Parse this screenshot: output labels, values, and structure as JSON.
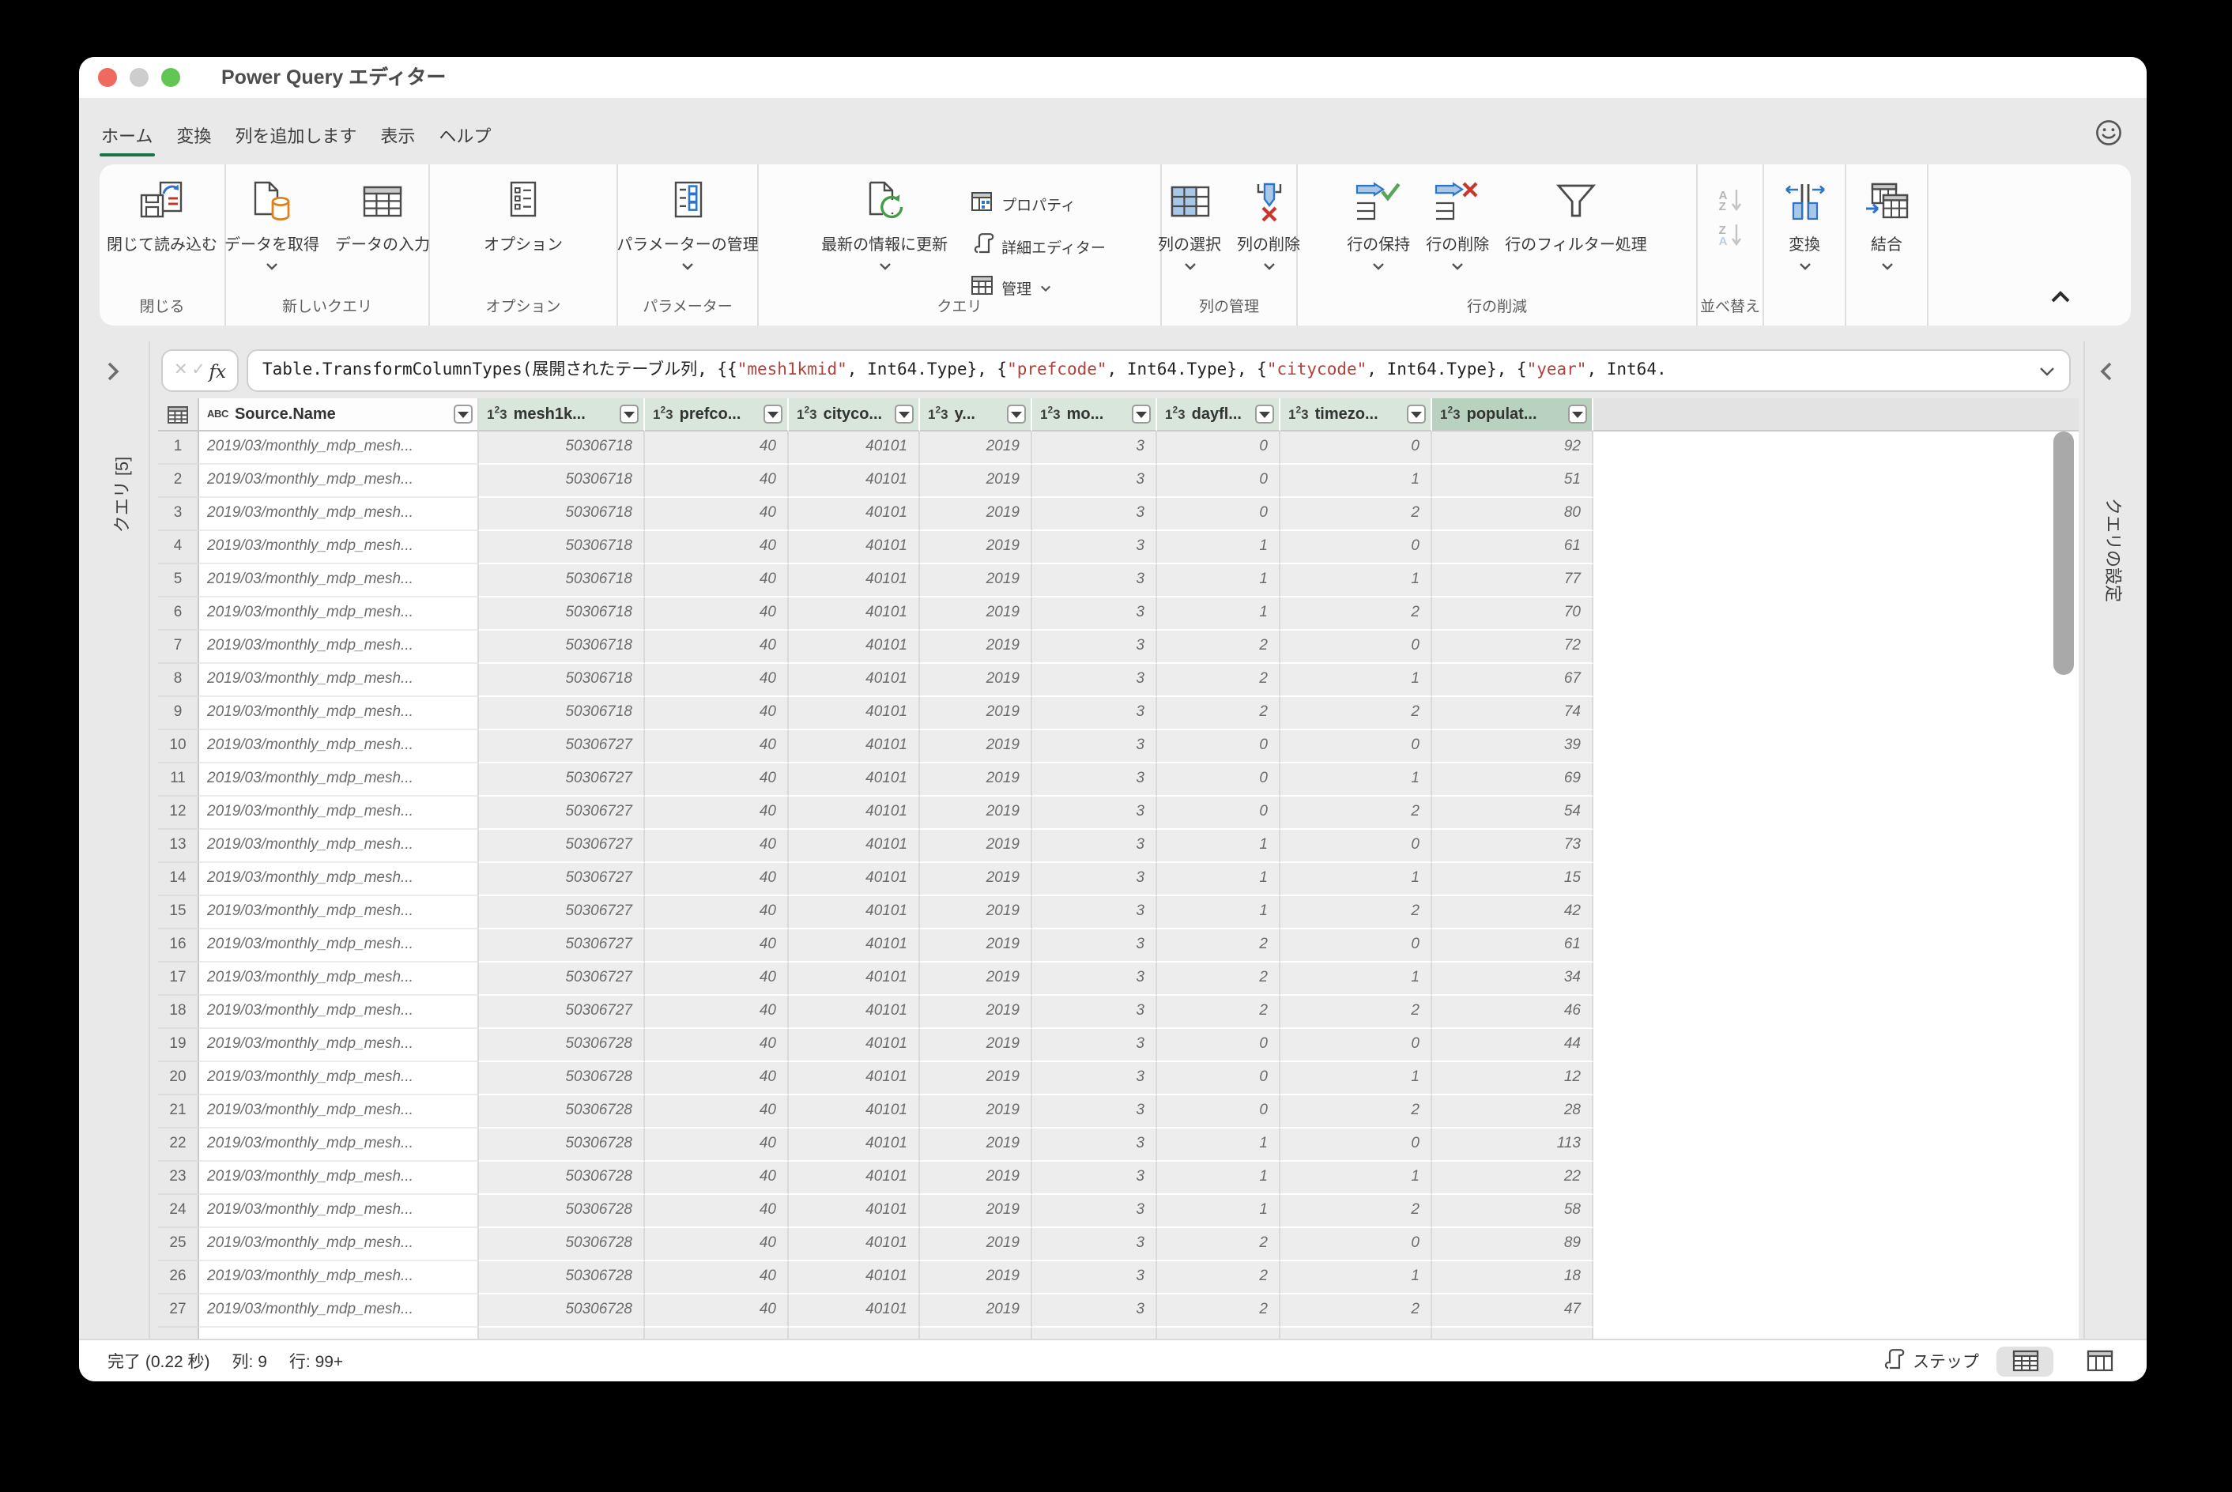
{
  "window_title": "Power Query エディター",
  "menu": {
    "tabs": [
      {
        "label": "ホーム",
        "active": true
      },
      {
        "label": "変換",
        "active": false
      },
      {
        "label": "列を追加します",
        "active": false
      },
      {
        "label": "表示",
        "active": false
      },
      {
        "label": "ヘルプ",
        "active": false
      }
    ]
  },
  "ribbon": {
    "groups": [
      {
        "label": "閉じる",
        "buttons": [
          {
            "label": "閉じて読み込む",
            "chevron": false
          }
        ]
      },
      {
        "label": "新しいクエリ",
        "buttons": [
          {
            "label": "データを取得",
            "chevron": true
          },
          {
            "label": "データの入力",
            "chevron": false
          }
        ]
      },
      {
        "label": "オプション",
        "buttons": [
          {
            "label": "オプション",
            "chevron": false
          }
        ]
      },
      {
        "label": "パラメーター",
        "buttons": [
          {
            "label": "パラメーターの管理",
            "chevron": true
          }
        ]
      },
      {
        "label": "クエリ",
        "buttons": [
          {
            "label": "最新の情報に更新",
            "chevron": true
          }
        ],
        "small_buttons": [
          {
            "label": "プロパティ"
          },
          {
            "label": "詳細エディター"
          },
          {
            "label": "管理",
            "chevron": true
          }
        ]
      },
      {
        "label": "列の管理",
        "buttons": [
          {
            "label": "列の選択",
            "chevron": true
          },
          {
            "label": "列の削除",
            "chevron": true
          }
        ]
      },
      {
        "label": "行の削減",
        "buttons": [
          {
            "label": "行の保持",
            "chevron": true
          },
          {
            "label": "行の削除",
            "chevron": true
          },
          {
            "label": "行のフィルター処理",
            "chevron": false
          }
        ]
      },
      {
        "label": "並べ替え",
        "buttons": []
      },
      {
        "label": "",
        "buttons": [
          {
            "label": "変換",
            "chevron": true
          }
        ]
      },
      {
        "label": "",
        "buttons": [
          {
            "label": "結合",
            "chevron": true
          }
        ]
      }
    ]
  },
  "formula_bar": {
    "segments": [
      {
        "kind": "code",
        "text": "Table.TransformColumnTypes(展開されたテーブル列, {{"
      },
      {
        "kind": "string",
        "text": "\"mesh1kmid\""
      },
      {
        "kind": "code",
        "text": ", Int64.Type}, {"
      },
      {
        "kind": "string",
        "text": "\"prefcode\""
      },
      {
        "kind": "code",
        "text": ", Int64.Type}, {"
      },
      {
        "kind": "string",
        "text": "\"citycode\""
      },
      {
        "kind": "code",
        "text": ", Int64.Type}, {"
      },
      {
        "kind": "string",
        "text": "\"year\""
      },
      {
        "kind": "code",
        "text": ", Int64."
      }
    ]
  },
  "left_panel": {
    "title": "クエリ [5]"
  },
  "right_panel": {
    "title": "クエリの設定"
  },
  "table": {
    "columns": [
      {
        "name": "Source.Name",
        "type": "text",
        "selected": false
      },
      {
        "name": "mesh1k...",
        "type": "number",
        "selected": false
      },
      {
        "name": "prefco...",
        "type": "number",
        "selected": false
      },
      {
        "name": "cityco...",
        "type": "number",
        "selected": false
      },
      {
        "name": "y...",
        "type": "number",
        "selected": false
      },
      {
        "name": "mo...",
        "type": "number",
        "selected": false
      },
      {
        "name": "dayfl...",
        "type": "number",
        "selected": false
      },
      {
        "name": "timezo...",
        "type": "number",
        "selected": false
      },
      {
        "name": "populat...",
        "type": "number",
        "selected": true
      }
    ],
    "rows": [
      [
        "2019/03/monthly_mdp_mesh...",
        "50306718",
        "40",
        "40101",
        "2019",
        "3",
        "0",
        "0",
        "92"
      ],
      [
        "2019/03/monthly_mdp_mesh...",
        "50306718",
        "40",
        "40101",
        "2019",
        "3",
        "0",
        "1",
        "51"
      ],
      [
        "2019/03/monthly_mdp_mesh...",
        "50306718",
        "40",
        "40101",
        "2019",
        "3",
        "0",
        "2",
        "80"
      ],
      [
        "2019/03/monthly_mdp_mesh...",
        "50306718",
        "40",
        "40101",
        "2019",
        "3",
        "1",
        "0",
        "61"
      ],
      [
        "2019/03/monthly_mdp_mesh...",
        "50306718",
        "40",
        "40101",
        "2019",
        "3",
        "1",
        "1",
        "77"
      ],
      [
        "2019/03/monthly_mdp_mesh...",
        "50306718",
        "40",
        "40101",
        "2019",
        "3",
        "1",
        "2",
        "70"
      ],
      [
        "2019/03/monthly_mdp_mesh...",
        "50306718",
        "40",
        "40101",
        "2019",
        "3",
        "2",
        "0",
        "72"
      ],
      [
        "2019/03/monthly_mdp_mesh...",
        "50306718",
        "40",
        "40101",
        "2019",
        "3",
        "2",
        "1",
        "67"
      ],
      [
        "2019/03/monthly_mdp_mesh...",
        "50306718",
        "40",
        "40101",
        "2019",
        "3",
        "2",
        "2",
        "74"
      ],
      [
        "2019/03/monthly_mdp_mesh...",
        "50306727",
        "40",
        "40101",
        "2019",
        "3",
        "0",
        "0",
        "39"
      ],
      [
        "2019/03/monthly_mdp_mesh...",
        "50306727",
        "40",
        "40101",
        "2019",
        "3",
        "0",
        "1",
        "69"
      ],
      [
        "2019/03/monthly_mdp_mesh...",
        "50306727",
        "40",
        "40101",
        "2019",
        "3",
        "0",
        "2",
        "54"
      ],
      [
        "2019/03/monthly_mdp_mesh...",
        "50306727",
        "40",
        "40101",
        "2019",
        "3",
        "1",
        "0",
        "73"
      ],
      [
        "2019/03/monthly_mdp_mesh...",
        "50306727",
        "40",
        "40101",
        "2019",
        "3",
        "1",
        "1",
        "15"
      ],
      [
        "2019/03/monthly_mdp_mesh...",
        "50306727",
        "40",
        "40101",
        "2019",
        "3",
        "1",
        "2",
        "42"
      ],
      [
        "2019/03/monthly_mdp_mesh...",
        "50306727",
        "40",
        "40101",
        "2019",
        "3",
        "2",
        "0",
        "61"
      ],
      [
        "2019/03/monthly_mdp_mesh...",
        "50306727",
        "40",
        "40101",
        "2019",
        "3",
        "2",
        "1",
        "34"
      ],
      [
        "2019/03/monthly_mdp_mesh...",
        "50306727",
        "40",
        "40101",
        "2019",
        "3",
        "2",
        "2",
        "46"
      ],
      [
        "2019/03/monthly_mdp_mesh...",
        "50306728",
        "40",
        "40101",
        "2019",
        "3",
        "0",
        "0",
        "44"
      ],
      [
        "2019/03/monthly_mdp_mesh...",
        "50306728",
        "40",
        "40101",
        "2019",
        "3",
        "0",
        "1",
        "12"
      ],
      [
        "2019/03/monthly_mdp_mesh...",
        "50306728",
        "40",
        "40101",
        "2019",
        "3",
        "0",
        "2",
        "28"
      ],
      [
        "2019/03/monthly_mdp_mesh...",
        "50306728",
        "40",
        "40101",
        "2019",
        "3",
        "1",
        "0",
        "113"
      ],
      [
        "2019/03/monthly_mdp_mesh...",
        "50306728",
        "40",
        "40101",
        "2019",
        "3",
        "1",
        "1",
        "22"
      ],
      [
        "2019/03/monthly_mdp_mesh...",
        "50306728",
        "40",
        "40101",
        "2019",
        "3",
        "1",
        "2",
        "58"
      ],
      [
        "2019/03/monthly_mdp_mesh...",
        "50306728",
        "40",
        "40101",
        "2019",
        "3",
        "2",
        "0",
        "89"
      ],
      [
        "2019/03/monthly_mdp_mesh...",
        "50306728",
        "40",
        "40101",
        "2019",
        "3",
        "2",
        "1",
        "18"
      ],
      [
        "2019/03/monthly_mdp_mesh...",
        "50306728",
        "40",
        "40101",
        "2019",
        "3",
        "2",
        "2",
        "47"
      ]
    ]
  },
  "statusbar": {
    "status": "完了 (0.22 秒)",
    "columns_info": "列: 9",
    "rows_info": "行: 99+",
    "steps_label": "ステップ"
  },
  "colors": {
    "accent_green": "#1c7145",
    "header_green": "#d8e6db",
    "header_green_selected": "#b9d2bf",
    "traffic_red": "#ee6a5f",
    "traffic_gray": "#cdcdcd",
    "traffic_green": "#62c554",
    "formula_string_red": "#b3403a"
  },
  "icons": {
    "titlebar": [
      "close",
      "minimize",
      "zoom"
    ],
    "menu_right": "smiley-feedback",
    "formula": [
      "cancel",
      "check",
      "fx",
      "chevron-down"
    ],
    "header_types": [
      "text-type-abc",
      "number-type-123"
    ],
    "statusbar": [
      "steps-scroll",
      "table-view",
      "column-view"
    ]
  }
}
